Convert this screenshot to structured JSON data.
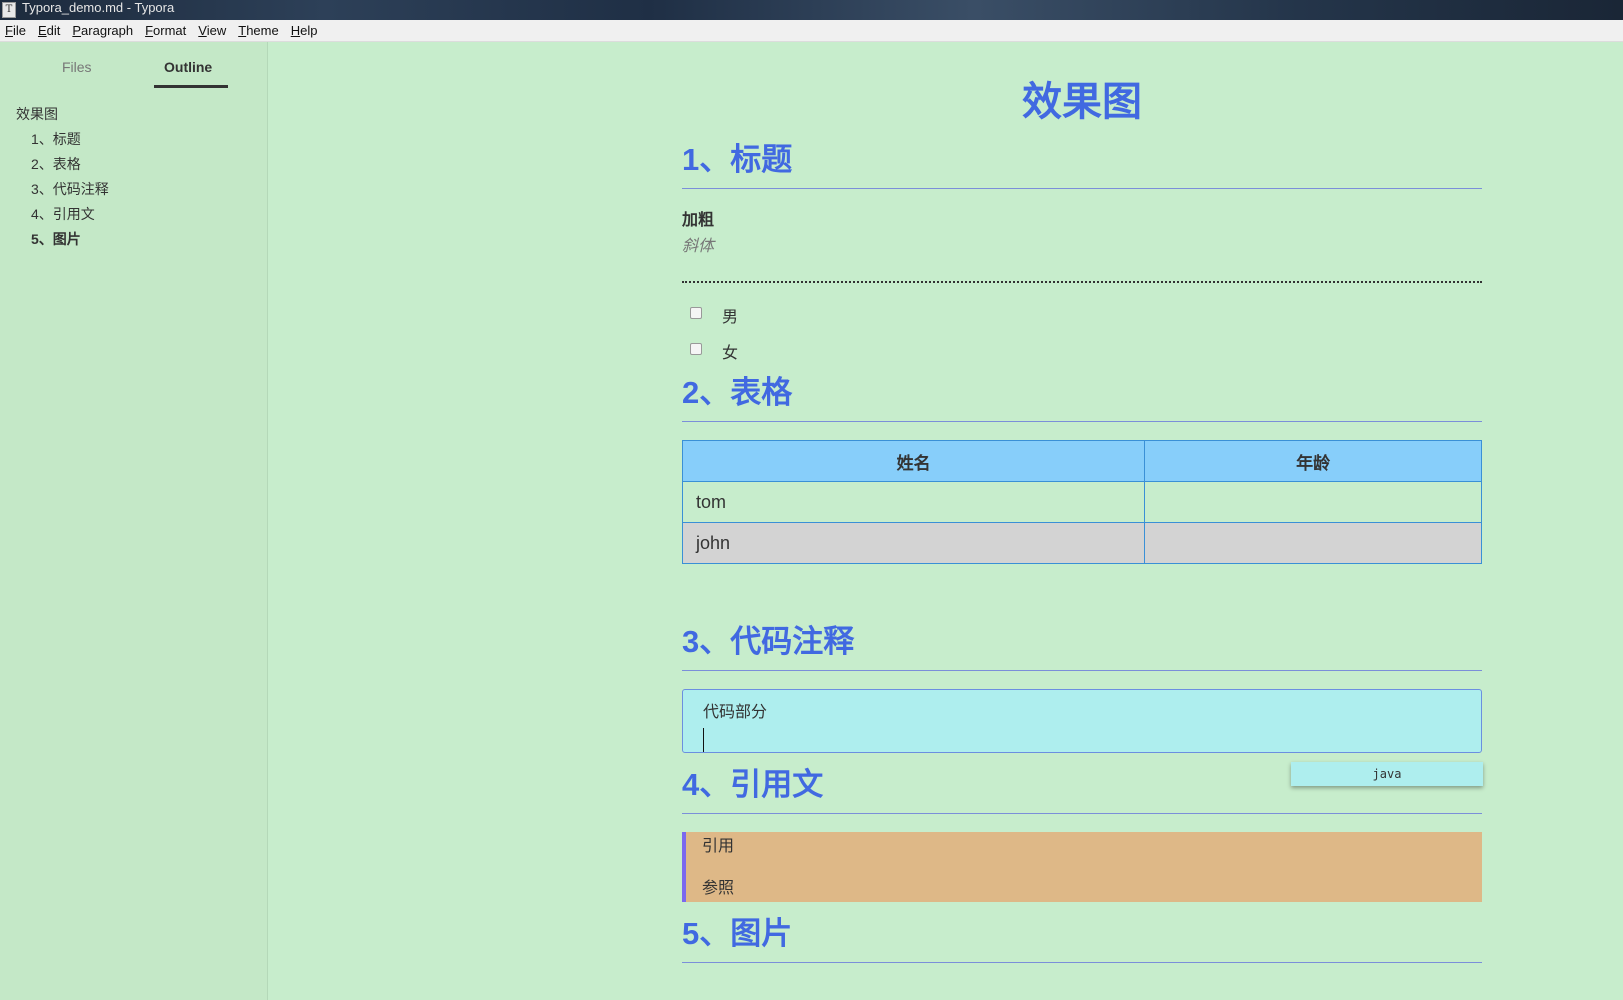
{
  "window": {
    "title": "Typora_demo.md - Typora",
    "icon_letter": "T"
  },
  "menu": [
    "File",
    "Edit",
    "Paragraph",
    "Format",
    "View",
    "Theme",
    "Help"
  ],
  "sidebar": {
    "tabs": [
      "Files",
      "Outline"
    ],
    "active_tab": "Outline",
    "outline": {
      "root": "效果图",
      "items": [
        "1、标题",
        "2、表格",
        "3、代码注释",
        "4、引用文",
        "5、图片"
      ],
      "active_index": 4
    }
  },
  "document": {
    "title": "效果图",
    "sections": [
      {
        "heading": "1、标题"
      },
      {
        "heading": "2、表格"
      },
      {
        "heading": "3、代码注释"
      },
      {
        "heading": "4、引用文"
      },
      {
        "heading": "5、图片"
      }
    ],
    "bold_text": "加粗",
    "italic_text": "斜体",
    "tasks": [
      "男",
      "女"
    ],
    "table": {
      "headers": [
        "姓名",
        "年龄"
      ],
      "rows": [
        [
          "tom",
          ""
        ],
        [
          "john",
          ""
        ]
      ]
    },
    "code": {
      "content": "代码部分",
      "language": "java"
    },
    "quote": {
      "line1": "引用",
      "line2": "参照"
    }
  },
  "colors": {
    "background": "#c7edcc",
    "heading": "#4169e1",
    "table_header": "#87cefa",
    "table_even_row": "#d3d3d3",
    "code_bg": "#aeeeee",
    "quote_bg": "#deb887",
    "quote_border": "#7b68ee"
  }
}
